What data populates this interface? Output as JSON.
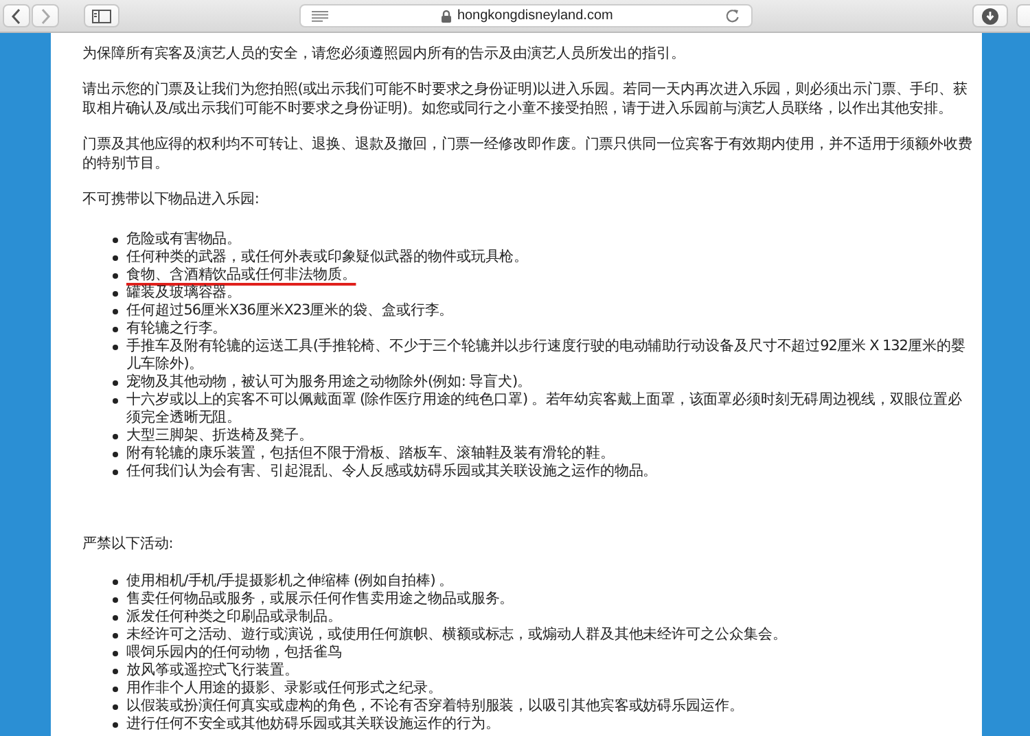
{
  "browser": {
    "url": "hongkongdisneyland.com"
  },
  "blocks": [
    {
      "kind": "paragraph",
      "text": "为保障所有宾客及演艺人员的安全，请您必须遵照园内所有的告示及由演艺人员所发出的指引。"
    },
    {
      "kind": "paragraph",
      "text": "请出示您的门票及让我们为您拍照(或出示我们可能不时要求之身份证明)以进入乐园。若同一天内再次进入乐园，则必须出示门票、手印、获取相片确认及/或出示我们可能不时要求之身份证明)。如您或同行之小童不接受拍照，请于进入乐园前与演艺人员联络，以作出其他安排。"
    },
    {
      "kind": "paragraph",
      "text": "门票及其他应得的权利均不可转让、退换、退款及撤回，门票一经修改即作废。门票只供同一位宾客于有效期内使用，并不适用于须额外收费的特别节目。"
    },
    {
      "kind": "paragraph",
      "text": "不可携带以下物品进入乐园:"
    },
    {
      "kind": "list",
      "items": [
        {
          "text": "危险或有害物品。",
          "underlined": false
        },
        {
          "text": "任何种类的武器，或任何外表或印象疑似武器的物件或玩具枪。",
          "underlined": false
        },
        {
          "text": "食物、含酒精饮品或任何非法物质。",
          "underlined": true
        },
        {
          "text": "罐装及玻璃容器。",
          "underlined": false
        },
        {
          "text": "任何超过56厘米X36厘米X23厘米的袋、盒或行李。",
          "underlined": false
        },
        {
          "text": "有轮辘之行李。",
          "underlined": false
        },
        {
          "text": "手推车及附有轮辘的运送工具(手推轮椅、不少于三个轮辘并以步行速度行驶的电动辅助行动设备及尺寸不超过92厘米 X 132厘米的婴儿车除外)。",
          "underlined": false
        },
        {
          "text": "宠物及其他动物，被认可为服务用途之动物除外(例如: 导盲犬)。",
          "underlined": false
        },
        {
          "text": "十六岁或以上的宾客不可以佩戴面罩 (除作医疗用途的纯色口罩) 。若年幼宾客戴上面罩，该面罩必须时刻无碍周边视线，双眼位置必须完全透晰无阻。",
          "underlined": false
        },
        {
          "text": "大型三脚架、折迭椅及凳子。",
          "underlined": false
        },
        {
          "text": "附有轮辘的康乐装置，包括但不限于滑板、踏板车、滚轴鞋及装有滑轮的鞋。",
          "underlined": false
        },
        {
          "text": "任何我们认为会有害、引起混乱、令人反感或妨碍乐园或其关联设施之运作的物品。",
          "underlined": false
        }
      ]
    },
    {
      "kind": "paragraph",
      "text": "严禁以下活动:"
    },
    {
      "kind": "list",
      "items": [
        {
          "text": "使用相机/手机/手提摄影机之伸缩棒 (例如自拍棒) 。",
          "underlined": false
        },
        {
          "text": "售卖任何物品或服务，或展示任何作售卖用途之物品或服务。",
          "underlined": false
        },
        {
          "text": "派发任何种类之印刷品或录制品。",
          "underlined": false
        },
        {
          "text": "未经许可之活动、遊行或演说，或使用任何旗帜、横额或标志，或煽动人群及其他未经许可之公众集会。",
          "underlined": false
        },
        {
          "text": "喂饲乐园内的任何动物，包括雀鸟",
          "underlined": false
        },
        {
          "text": "放风筝或遥控式飞行装置。",
          "underlined": false
        },
        {
          "text": "用作非个人用途的摄影、录影或任何形式之纪录。",
          "underlined": false
        },
        {
          "text": "以假装或扮演任何真实或虚构的角色，不论有否穿着特别服装，以吸引其他宾客或妨碍乐园运作。",
          "underlined": false
        },
        {
          "text": "进行任何不安全或其他妨碍乐园或其关联设施运作的行为。",
          "underlined": false
        }
      ]
    }
  ]
}
